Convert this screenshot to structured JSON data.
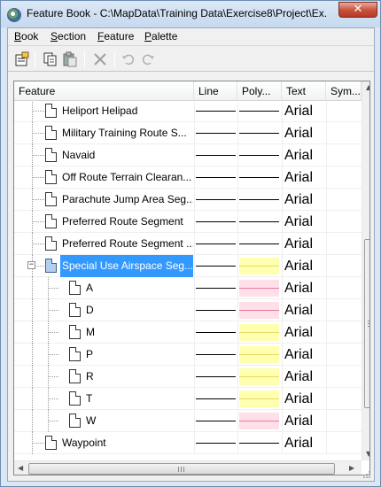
{
  "window": {
    "title": "Feature Book - C:\\MapData\\Training Data\\Exercise8\\Project\\Ex...",
    "close_glyph": "✕"
  },
  "menu": {
    "items": [
      {
        "label": "Book",
        "underline": "B",
        "rest": "ook"
      },
      {
        "label": "Section",
        "underline": "S",
        "rest": "ection"
      },
      {
        "label": "Feature",
        "underline": "F",
        "rest": "eature"
      },
      {
        "label": "Palette",
        "underline": "P",
        "rest": "alette"
      }
    ]
  },
  "toolbar": {
    "icons": [
      "properties-icon",
      "copy-icon",
      "paste-icon",
      "delete-icon",
      "undo-icon",
      "redo-icon"
    ]
  },
  "grid": {
    "columns": [
      "Feature",
      "Line",
      "Poly...",
      "Text",
      "Sym..."
    ],
    "rows": [
      {
        "name": "Heliport Helipad",
        "line": true,
        "poly": "line",
        "text": "Arial"
      },
      {
        "name": "Military Training Route S...",
        "line": true,
        "poly": "line",
        "text": "Arial"
      },
      {
        "name": "Navaid",
        "line": true,
        "poly": "line",
        "text": "Arial"
      },
      {
        "name": "Off Route Terrain Clearan...",
        "line": true,
        "poly": "line",
        "text": "Arial"
      },
      {
        "name": "Parachute Jump Area Seg...",
        "line": true,
        "poly": "line",
        "text": "Arial"
      },
      {
        "name": "Preferred Route Segment",
        "line": true,
        "poly": "line",
        "text": "Arial"
      },
      {
        "name": "Preferred Route Segment ...",
        "line": true,
        "poly": "line",
        "text": "Arial"
      },
      {
        "name": "Special Use Airspace Seg...",
        "line": true,
        "poly": "yellow",
        "text": "Arial",
        "group": true,
        "selected": true,
        "expanded": true
      },
      {
        "name": "A",
        "line": true,
        "poly": "pink",
        "text": "Arial",
        "child": true
      },
      {
        "name": "D",
        "line": true,
        "poly": "pink",
        "text": "Arial",
        "child": true
      },
      {
        "name": "M",
        "line": true,
        "poly": "yellow",
        "text": "Arial",
        "child": true
      },
      {
        "name": "P",
        "line": true,
        "poly": "yellow",
        "text": "Arial",
        "child": true
      },
      {
        "name": "R",
        "line": true,
        "poly": "yellow",
        "text": "Arial",
        "child": true
      },
      {
        "name": "T",
        "line": true,
        "poly": "yellow",
        "text": "Arial",
        "child": true
      },
      {
        "name": "W",
        "line": true,
        "poly": "pink",
        "text": "Arial",
        "child": true
      },
      {
        "name": "Waypoint",
        "line": true,
        "poly": "line",
        "text": "Arial"
      }
    ]
  },
  "colors": {
    "selection": "#3399ff",
    "poly_yellow_fill": "#ffffb0",
    "poly_yellow_edge": "#e8d86a",
    "poly_pink_fill": "#ffe0e8",
    "poly_pink_edge": "#e87a98"
  }
}
